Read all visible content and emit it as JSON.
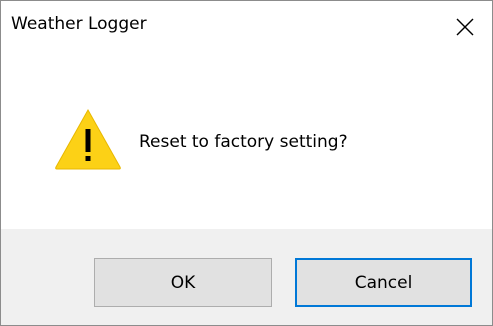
{
  "window": {
    "title": "Weather Logger",
    "close_glyph": "✕"
  },
  "dialog": {
    "icon": "warning-icon",
    "message": "Reset to factory setting?"
  },
  "buttons": {
    "ok_label": "OK",
    "cancel_label": "Cancel",
    "default": "cancel"
  },
  "colors": {
    "warning_fill": "#fcd116",
    "warning_glyph": "#000000",
    "focus_border": "#0078d7",
    "footer_bg": "#f0f0f0"
  }
}
